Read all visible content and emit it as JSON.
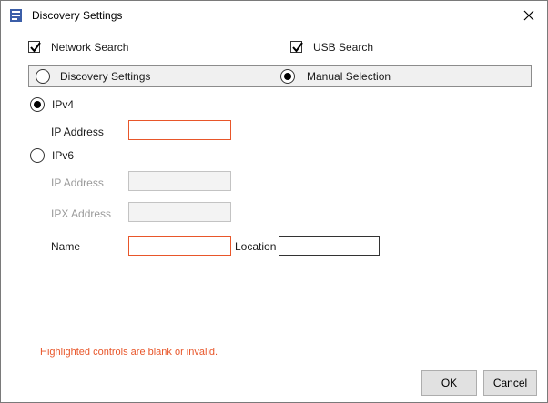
{
  "window": {
    "title": "Discovery Settings",
    "close_glyph": "✕"
  },
  "search": {
    "network_label": "Network Search",
    "network_checked": true,
    "usb_label": "USB Search",
    "usb_checked": true
  },
  "mode": {
    "discovery_label": "Discovery Settings",
    "discovery_selected": false,
    "manual_label": "Manual Selection",
    "manual_selected": true
  },
  "ipv4": {
    "label": "IPv4",
    "selected": true,
    "ip_label": "IP Address",
    "ip_value": ""
  },
  "ipv6": {
    "label": "IPv6",
    "selected": false,
    "ip_label": "IP Address",
    "ip_value": "",
    "ipx_label": "IPX Address",
    "ipx_value": ""
  },
  "name": {
    "label": "Name",
    "value": ""
  },
  "location": {
    "label": "Location",
    "value": ""
  },
  "error_text": "Highlighted controls are blank or invalid.",
  "buttons": {
    "ok": "OK",
    "cancel": "Cancel"
  },
  "colors": {
    "error": "#e8562a",
    "icon_blue": "#3b5ea8"
  },
  "icons": {
    "app": "printer-settings-icon",
    "close": "close-icon",
    "check": "checkmark-icon"
  }
}
